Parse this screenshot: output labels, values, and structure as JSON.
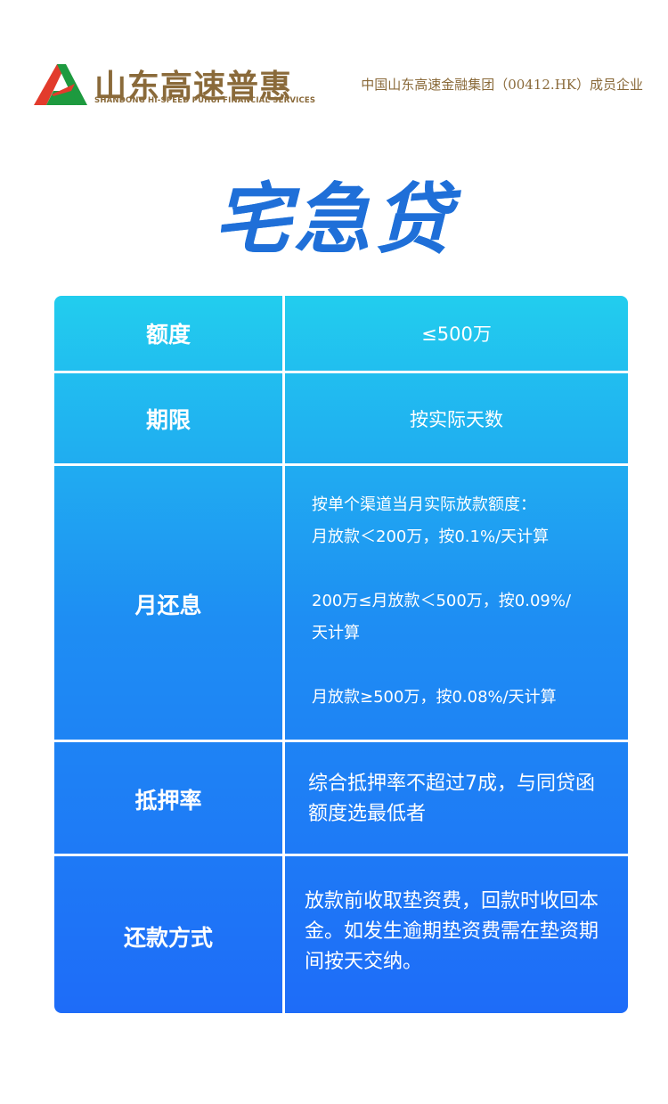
{
  "header": {
    "logo_text": "山东高速普惠",
    "logo_subtitle": "SHANDONG HI-SPEED PUHUI FINANCIAL SERVICES",
    "group_text": "中国山东高速金融集团（00412.HK）成员企业"
  },
  "title": "宅急贷",
  "colors": {
    "brand_gold": "#8a6a3a",
    "table_top": "#22cdee",
    "table_bottom": "#1e6cf8"
  },
  "rows": [
    {
      "label": "额度",
      "value": "≤500万"
    },
    {
      "label": "期限",
      "value": "按实际天数"
    },
    {
      "label": "月还息",
      "lines": [
        "按单个渠道当月实际放款额度：",
        "月放款＜200万，按0.1%/天计算",
        "",
        "200万≤月放款＜500万，按0.09%/",
        "天计算",
        "",
        "月放款≥500万，按0.08%/天计算"
      ]
    },
    {
      "label": "抵押率",
      "value": "综合抵押率不超过7成，与同贷函额度选最低者"
    },
    {
      "label": "还款方式",
      "value": "放款前收取垫资费，回款时收回本金。如发生逾期垫资费需在垫资期间按天交纳。"
    }
  ]
}
